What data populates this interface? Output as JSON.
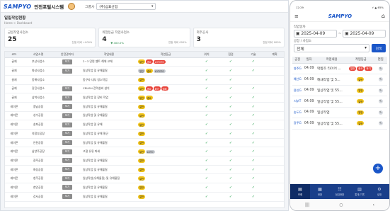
{
  "desktop": {
    "logo": "SAMPYO",
    "system_title": "안전포털시스템",
    "company_label": "그룹사",
    "company_value": "(주)삼표산업",
    "page_title": "일일작업현황",
    "breadcrumb": "Home > Dashboard",
    "cards": [
      {
        "title": "금일작업사업소",
        "value": "25",
        "rate": "",
        "note": "전일 대비 +000%"
      },
      {
        "title": "위험등급 작업사업소",
        "value": "4",
        "rate": "▼ 400.0%",
        "note": "전일 대비 000%"
      },
      {
        "title": "외주공사",
        "value": "3",
        "rate": "",
        "note": "전일 대비 000%"
      }
    ],
    "table": {
      "headers": [
        "코드",
        "사업소명",
        "안전관리자",
        "작업내용",
        "작업등급",
        "위치",
        "점검",
        "기술",
        "계획"
      ],
      "rows": [
        {
          "code": "골재",
          "name": "부산사업소",
          "btn": "보기",
          "work": "2~3 단면 벨트 해체 교체",
          "tags": [
            [
              "y",
              "일반"
            ],
            [
              "r",
              "중요"
            ],
            [
              "r",
              "LOTOTO"
            ]
          ],
          "c": [
            "✓",
            "✓",
            "✓"
          ]
        },
        {
          "code": "골재",
          "name": "화성사업소",
          "btn": "보기",
          "work": "일상작업 및 유해물질",
          "tags": [
            [
              "g",
              "일반"
            ],
            [
              "y",
              "중요"
            ],
            [
              "g",
              "LOTOTO"
            ]
          ],
          "c": [
            "✓",
            "✓",
            "✓"
          ]
        },
        {
          "code": "골재",
          "name": "동해사업소",
          "btn": "",
          "work": "동구라 내부 청소작업",
          "tags": [
            [
              "y",
              "일반"
            ]
          ],
          "c": [
            "✓",
            "✓",
            ""
          ]
        },
        {
          "code": "골재",
          "name": "당진사업소",
          "btn": "보기",
          "work": "CRUSH 전력설비 설치",
          "tags": [
            [
              "y",
              "일반"
            ],
            [
              "r",
              "중요"
            ],
            [
              "r",
              "화기"
            ],
            [
              "r",
              "밀폐"
            ]
          ],
          "c": [
            "✓",
            "✓",
            "✓"
          ]
        },
        {
          "code": "골재",
          "name": "삼척사업소",
          "btn": "보기",
          "work": "일상작업 및 장비 작업",
          "tags": [
            [
              "y",
              "일반"
            ],
            [
              "y",
              "중요"
            ]
          ],
          "c": [
            "✓",
            "✓",
            "✓"
          ]
        },
        {
          "code": "레미콘",
          "name": "풍납공장",
          "btn": "보기",
          "work": "일상작업 및 유해물질",
          "tags": [
            [
              "y",
              "일반"
            ]
          ],
          "c": [
            "✓",
            "✓",
            "✓"
          ]
        },
        {
          "code": "레미콘",
          "name": "성수공장",
          "btn": "보기",
          "work": "일상작업 및 유해물질",
          "tags": [
            [
              "y",
              "일반"
            ]
          ],
          "c": [
            "✓",
            "✓",
            "✓"
          ]
        },
        {
          "code": "레미콘",
          "name": "송파공장",
          "btn": "보기",
          "work": "일상작업 및 유해",
          "tags": [
            [
              "y",
              "일반"
            ]
          ],
          "c": [
            "✓",
            "✓",
            "✓"
          ]
        },
        {
          "code": "레미콘",
          "name": "의정부공장",
          "btn": "보기",
          "work": "일상작업 및 유해 철근",
          "tags": [
            [
              "y",
              "일반"
            ]
          ],
          "c": [
            "✓",
            "✓",
            "✓"
          ]
        },
        {
          "code": "레미콘",
          "name": "인천공장",
          "btn": "보기",
          "work": "일상작업 및 유해물질",
          "tags": [
            [
              "y",
              "일반"
            ]
          ],
          "c": [
            "✓",
            "✓",
            "✓"
          ]
        },
        {
          "code": "레미콘",
          "name": "남양주공장",
          "btn": "보기",
          "work": "고철 유류 파쇄",
          "tags": [
            [
              "y",
              "일반"
            ],
            [
              "g",
              "LOTO"
            ]
          ],
          "c": [
            "✓",
            "✓",
            "✓"
          ]
        },
        {
          "code": "레미콘",
          "name": "광주공장",
          "btn": "보기",
          "work": "일상작업 및 유해물질",
          "tags": [
            [
              "y",
              "일반"
            ]
          ],
          "c": [
            "✓",
            "✓",
            "✓"
          ]
        },
        {
          "code": "레미콘",
          "name": "화성공장",
          "btn": "보기",
          "work": "일상작업 및 유해물질",
          "tags": [
            [
              "y",
              "일반"
            ]
          ],
          "c": [
            "✓",
            "✓",
            "✓"
          ]
        },
        {
          "code": "레미콘",
          "name": "청주공장",
          "btn": "보기",
          "work": "일상작업(유해물질) 및 유해물질",
          "tags": [
            [
              "y",
              "일반"
            ]
          ],
          "c": [
            "✓",
            "✓",
            "✓"
          ]
        },
        {
          "code": "레미콘",
          "name": "천안공장",
          "btn": "보기",
          "work": "일상작업 및 유해물질",
          "tags": [
            [
              "y",
              "일반"
            ]
          ],
          "c": [
            "✓",
            "✓",
            "✓"
          ]
        },
        {
          "code": "레미콘",
          "name": "강서공장",
          "btn": "보기",
          "work": "일상작업 및 유해물질",
          "tags": [
            [
              "y",
              "일반"
            ]
          ],
          "c": [
            "✓",
            "✓",
            "✓"
          ]
        }
      ]
    }
  },
  "mobile": {
    "status_time": "12:29",
    "status_right": "⚡ ▲ 65%",
    "logo": "SAMPYO",
    "date_label": "작업일자",
    "date_from": "2025-04-09",
    "date_to": "2025-04-09",
    "site_label": "공장 / 사업소",
    "site_value": "전체",
    "search_label": "검색",
    "headers": [
      "공장",
      "일자",
      "작업내용",
      "작업등급",
      "편집"
    ],
    "rows": [
      {
        "site": "영주G",
        "date": "04.09",
        "work": "떡밥조 타이어 ...",
        "tags": [
          [
            "r",
            "일반"
          ],
          [
            "r",
            "중요"
          ],
          [
            "r",
            "화기"
          ]
        ]
      },
      {
        "site": "예산G",
        "date": "04.09",
        "work": "해쇄작업 및 5...",
        "tags": [
          [
            "y",
            "일반"
          ]
        ]
      },
      {
        "site": "용인G",
        "date": "04.09",
        "work": "일상작업 및 55...",
        "tags": [
          [
            "y",
            "일반"
          ]
        ]
      },
      {
        "site": "서부T",
        "date": "04.09",
        "work": "일상작업 및 55...",
        "tags": [
          [
            "y",
            "일반"
          ]
        ]
      },
      {
        "site": "송도G",
        "date": "04.09",
        "work": "일상작업",
        "tags": [
          [
            "y",
            "일반"
          ]
        ]
      },
      {
        "site": "광주G",
        "date": "04.09",
        "work": "일상작업 및 55...",
        "tags": [
          [
            "y",
            "일반"
          ]
        ]
      }
    ],
    "nav": [
      {
        "icon": "▤",
        "label": "조회"
      },
      {
        "icon": "▦",
        "label": "현황"
      },
      {
        "icon": "☷",
        "label": "점검현황"
      },
      {
        "icon": "▥",
        "label": "통계/기록"
      },
      {
        "icon": "⚙",
        "label": "설정"
      }
    ],
    "gesture": [
      "|||",
      "○",
      "‹"
    ]
  }
}
